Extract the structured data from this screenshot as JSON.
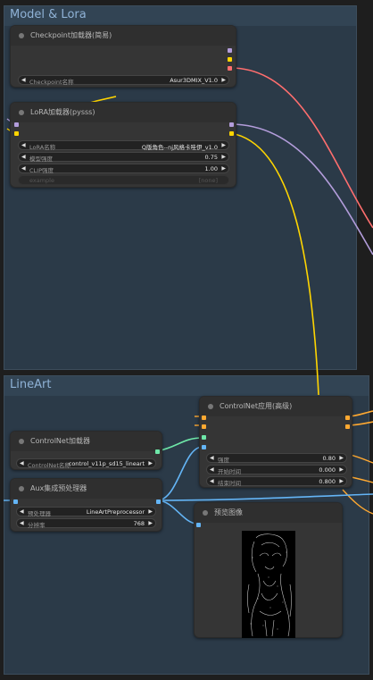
{
  "colors": {
    "model_wire": "#b39ddb",
    "clip_wire": "#ffd500",
    "vae_wire": "#ff6e6e",
    "image_wire": "#64b5f6",
    "cond_wire": "#ffa931",
    "controlnet_wire": "#6ee7a8"
  },
  "groups": {
    "model_lora": {
      "title": "Model & Lora"
    },
    "lineart": {
      "title": "LineArt"
    }
  },
  "checkpoint_node": {
    "title": "Checkpoint加载器(简易)",
    "ckpt_label": "Checkpoint名称",
    "ckpt_value": "Asur3DMIX_V1.0"
  },
  "lora_node": {
    "title": "LoRA加载器(pysss)",
    "lora_label": "LoRA名称",
    "lora_value": "Q版角色--nj风格卡哇伊_v1.0",
    "model_strength_label": "模型强度",
    "model_strength_value": "0.75",
    "clip_strength_label": "CLIP强度",
    "clip_strength_value": "1.00",
    "example_label": "example",
    "example_value": "[none]"
  },
  "controlnet_loader_node": {
    "title": "ControlNet加载器",
    "name_label": "ControlNet名称",
    "name_value": "control_v11p_sd15_lineart"
  },
  "aux_node": {
    "title": "Aux集成预处理器",
    "preprocessor_label": "预处理器",
    "preprocessor_value": "LineArtPreprocessor",
    "resolution_label": "分辨率",
    "resolution_value": "768"
  },
  "controlnet_apply_node": {
    "title": "ControlNet应用(高级)",
    "strength_label": "强度",
    "strength_value": "0.80",
    "start_label": "开始时间",
    "start_value": "0.000",
    "end_label": "结束时间",
    "end_value": "0.800"
  },
  "preview_node": {
    "title": "预览图像"
  }
}
